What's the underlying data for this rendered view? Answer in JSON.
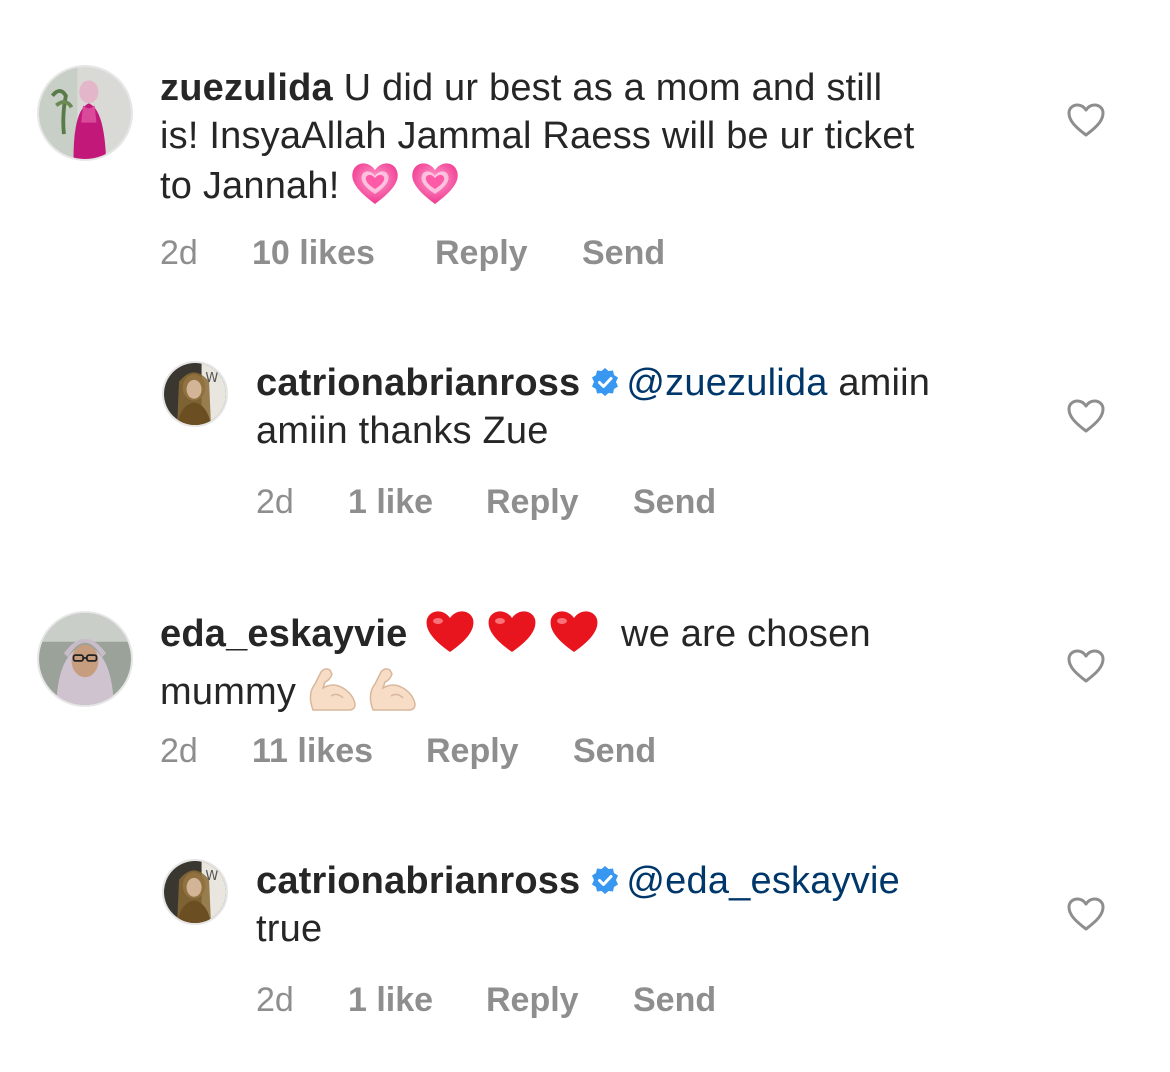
{
  "comments": [
    {
      "username": "zuezulida",
      "text_line1": "U did ur best as a mom and still",
      "text_line2": "is! InsyaAllah Jammal Raess will be ur ticket",
      "text_line3": "to Jannah!",
      "time": "2d",
      "likes": "10 likes",
      "reply_label": "Reply",
      "send_label": "Send",
      "emojis": [
        "growing-heart-emoji",
        "growing-heart-emoji"
      ]
    },
    {
      "username": "catrionabrianross",
      "verified": true,
      "mention": "@zuezulida",
      "text_line1": "amiin",
      "text_line2": "amiin thanks Zue",
      "time": "2d",
      "likes": "1 like",
      "reply_label": "Reply",
      "send_label": "Send"
    },
    {
      "username": "eda_eskayvie",
      "text_line1": "we are chosen",
      "text_line2": "mummy",
      "time": "2d",
      "likes": "11 likes",
      "reply_label": "Reply",
      "send_label": "Send",
      "emojis": [
        "red-heart-emoji",
        "red-heart-emoji",
        "red-heart-emoji",
        "flexed-biceps-emoji",
        "flexed-biceps-emoji"
      ]
    },
    {
      "username": "catrionabrianross",
      "verified": true,
      "mention": "@eda_eskayvie",
      "text_line2": "true",
      "time": "2d",
      "likes": "1 like",
      "reply_label": "Reply",
      "send_label": "Send"
    }
  ],
  "colors": {
    "text": "#262626",
    "secondary": "#8e8e8e",
    "mention": "#00376b",
    "verified": "#3897f0"
  }
}
